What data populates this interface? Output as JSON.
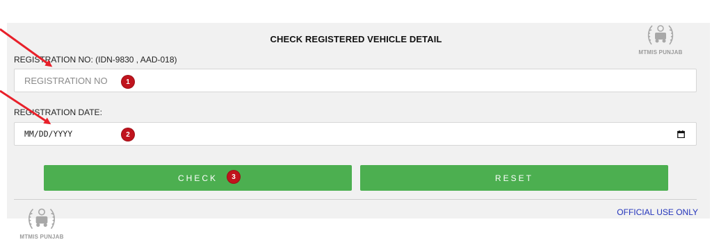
{
  "form": {
    "title": "CHECK REGISTERED VEHICLE DETAIL",
    "registration_label": "REGISTRATION NO: (IDN-9830 , AAD-018)",
    "registration_placeholder": "REGISTRATION NO",
    "date_label": "REGISTRATION DATE:",
    "date_placeholder": "MM/DD/YYYY"
  },
  "buttons": {
    "check_label": "CHECK",
    "reset_label": "RESET"
  },
  "footer": {
    "official_text": "OFFICIAL USE ONLY"
  },
  "logo": {
    "text": "MTMIS PUNJAB"
  },
  "annotations": {
    "step1": "1",
    "step2": "2",
    "step3": "3"
  },
  "icons": {
    "calendar": "calendar-icon",
    "logo_emblem": "mtmis-emblem-icon",
    "arrow": "red-arrow-icon"
  },
  "colors": {
    "button_green": "#4caf50",
    "badge_red": "#c0131d",
    "official_blue": "#2233bb",
    "panel_gray": "#f1f1f1",
    "arrow_red": "#e8202a"
  }
}
